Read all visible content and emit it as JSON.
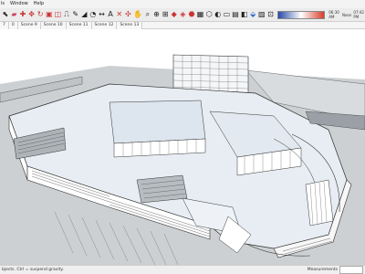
{
  "menu": [
    "ls",
    "Window",
    "Help"
  ],
  "toolbar": {
    "icons": [
      "select-icon",
      "eraser-icon",
      "paint-icon",
      "move-icon",
      "rotate-icon",
      "scale-icon",
      "offset-icon",
      "pushpull-icon",
      "followme-icon",
      "tape-icon",
      "protractor-icon",
      "dimension-icon",
      "text-icon",
      "axes-icon",
      "orbit-icon",
      "pan-icon",
      "zoom-icon",
      "zoom-extents-icon",
      "zoom-window-icon",
      "prev-view-icon",
      "warehouse-icon",
      "extension-icon",
      "layer-icon",
      "component-icon",
      "shadow-icon",
      "fog-icon",
      "style-icon",
      "section-icon",
      "section-cut-icon",
      "materials-icon",
      "location-icon"
    ],
    "shadow_labels": [
      "06:30 AM",
      "Noon",
      "07:42 PM"
    ]
  },
  "scenes": [
    "7",
    "0",
    "Scene 9",
    "Scene 10",
    "Scene 11",
    "Scene 12",
    "Scene 13"
  ],
  "status": {
    "hint": "bjects. Ctrl = suspend gravity.",
    "measurements_label": "Measurements"
  },
  "colors": {
    "ground": "#c9ccce",
    "roof": "#e8eef4",
    "wall": "#ffffff",
    "line": "#3a3a3a"
  }
}
